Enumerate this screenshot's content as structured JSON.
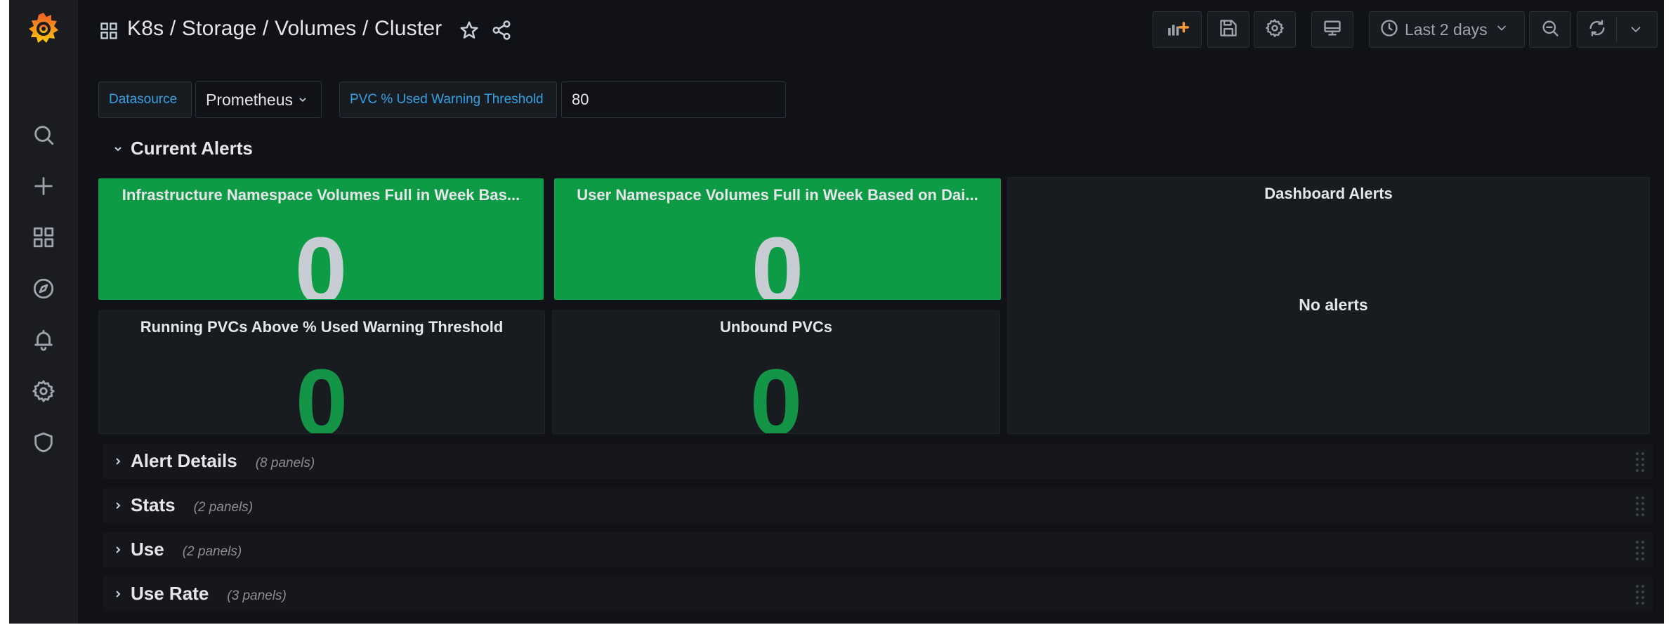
{
  "topbar": {
    "title": "K8s / Storage / Volumes / Cluster",
    "time_range": "Last 2 days"
  },
  "variables": {
    "datasource_label": "Datasource",
    "datasource_value": "Prometheus",
    "threshold_label": "PVC % Used Warning Threshold",
    "threshold_value": "80"
  },
  "rows": {
    "current_alerts": "Current Alerts",
    "collapsed": [
      {
        "title": "Alert Details",
        "count": "(8 panels)"
      },
      {
        "title": "Stats",
        "count": "(2 panels)"
      },
      {
        "title": "Use",
        "count": "(2 panels)"
      },
      {
        "title": "Use Rate",
        "count": "(3 panels)"
      }
    ]
  },
  "panels": {
    "infra": {
      "title": "Infrastructure Namespace Volumes Full in Week Bas...",
      "value": "0"
    },
    "user": {
      "title": "User Namespace Volumes Full in Week Based on Dai...",
      "value": "0"
    },
    "running": {
      "title": "Running PVCs Above % Used Warning Threshold",
      "value": "0"
    },
    "unbound": {
      "title": "Unbound PVCs",
      "value": "0"
    },
    "alerts": {
      "title": "Dashboard Alerts",
      "empty_text": "No alerts"
    }
  },
  "colors": {
    "background": "#111217",
    "sidebar": "#1b1c20",
    "stat_green": "#0d9c45",
    "value_green": "#139447",
    "link_blue": "#33a2e5"
  }
}
